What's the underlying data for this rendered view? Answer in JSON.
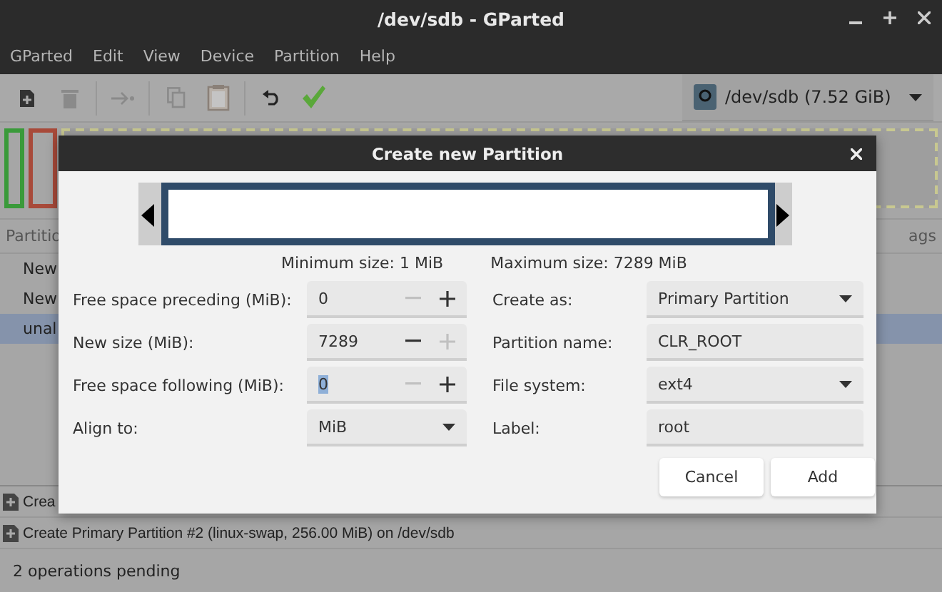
{
  "window": {
    "title": "/dev/sdb - GParted"
  },
  "menu": [
    "GParted",
    "Edit",
    "View",
    "Device",
    "Partition",
    "Help"
  ],
  "toolbar": [
    {
      "kind": "new",
      "disabled": false
    },
    {
      "kind": "delete",
      "disabled": true
    },
    {
      "kind": "separator"
    },
    {
      "kind": "resize",
      "disabled": true
    },
    {
      "kind": "separator"
    },
    {
      "kind": "copy",
      "disabled": true
    },
    {
      "kind": "paste",
      "disabled": true
    },
    {
      "kind": "separator"
    },
    {
      "kind": "undo",
      "disabled": false
    },
    {
      "kind": "apply",
      "disabled": false
    }
  ],
  "device_selector": {
    "label": "/dev/sdb (7.52 GiB)"
  },
  "disk_map": [
    {
      "color": "#3a9a3a"
    },
    {
      "color": "#a84a3a"
    },
    {
      "color": "#c8c890"
    }
  ],
  "partition_list": {
    "columns": [
      "Partitio",
      "ags"
    ],
    "rows": [
      {
        "name": "New",
        "selected": false
      },
      {
        "name": "New",
        "selected": false
      },
      {
        "name": "unal",
        "selected": true
      }
    ]
  },
  "operations": [
    "Crea",
    "Create Primary Partition #2 (linux-swap, 256.00 MiB) on /dev/sdb"
  ],
  "status_bar": "2 operations pending",
  "dialog": {
    "title": "Create new Partition",
    "min_size": "Minimum size: 1 MiB",
    "max_size": "Maximum size: 7289 MiB",
    "left_fields": [
      {
        "kind": "spin",
        "label": "Free space preceding (MiB):",
        "value": "0",
        "minus_disabled": true,
        "plus_disabled": false,
        "text_selected": false
      },
      {
        "kind": "spin",
        "label": "New size (MiB):",
        "value": "7289",
        "minus_disabled": false,
        "plus_disabled": true,
        "text_selected": false
      },
      {
        "kind": "spin",
        "label": "Free space following (MiB):",
        "value": "0",
        "minus_disabled": true,
        "plus_disabled": false,
        "text_selected": true
      },
      {
        "kind": "dropdown",
        "label": "Align to:",
        "value": "MiB"
      }
    ],
    "right_fields": [
      {
        "kind": "dropdown",
        "label": "Create as:",
        "value": "Primary Partition"
      },
      {
        "kind": "text",
        "label": "Partition name:",
        "value": "CLR_ROOT"
      },
      {
        "kind": "dropdown",
        "label": "File system:",
        "value": "ext4"
      },
      {
        "kind": "text",
        "label": "Label:",
        "value": "root"
      }
    ],
    "buttons": [
      "Cancel",
      "Add"
    ]
  }
}
